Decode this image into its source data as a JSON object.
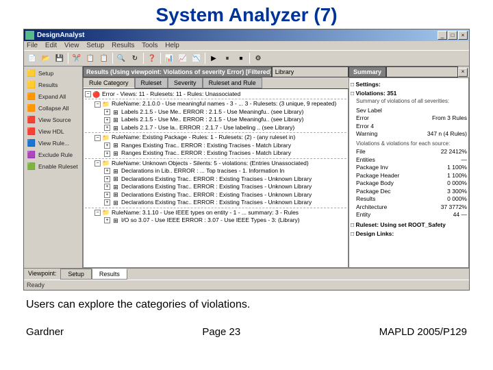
{
  "title": "System Analyzer (7)",
  "app": {
    "title": "DesignAnalyst",
    "menus": [
      "File",
      "Edit",
      "View",
      "Setup",
      "Results",
      "Tools",
      "Help"
    ],
    "toolbar_icons": [
      "📄",
      "📂",
      "💾",
      "|",
      "✂️",
      "📋",
      "📋",
      "|",
      "🔍",
      "↻",
      "|",
      "❓",
      "|",
      "📊",
      "📈",
      "📉",
      "|",
      "▶",
      "⏸",
      "⏹",
      "|",
      "⚙"
    ]
  },
  "sidebar": {
    "items": [
      {
        "icon": "🟨",
        "label": "Setup"
      },
      {
        "icon": "🟨",
        "label": "Results"
      },
      {
        "icon": "🟧",
        "label": "Expand All"
      },
      {
        "icon": "🟧",
        "label": "Collapse All"
      },
      {
        "icon": "🟥",
        "label": "View Source"
      },
      {
        "icon": "🟥",
        "label": "View HDL"
      },
      {
        "icon": "🟦",
        "label": "View Rule..."
      },
      {
        "icon": "🟪",
        "label": "Exclude Rule"
      },
      {
        "icon": "🟩",
        "label": "Enable Ruleset"
      }
    ]
  },
  "center": {
    "tab_main": "Results (Using viewpoint: Violations of severity Error) [Filtered]",
    "tab_lib": "Library",
    "sub_tabs": [
      "Rule Category",
      "Ruleset",
      "Severity",
      "Ruleset and Rule"
    ],
    "tree": [
      {
        "ind": 0,
        "box": "−",
        "icon": "🔴",
        "text": "Error - Views: 11 - Rulesets: 11 - Rules: Unassociated"
      },
      {
        "hr": true
      },
      {
        "ind": 1,
        "box": "−",
        "icon": "📁",
        "text": "RuleName: 2.1.0.0 - Use meaningful names - 3 - ... 3 - Rulesets: (3 unique, 9 repeated)"
      },
      {
        "ind": 2,
        "box": "",
        "icon": "⊞",
        "text": "Labels     2.1.5 - Use Me.. ERROR : 2.1.5 - Use Meaningfu.. (see Library)"
      },
      {
        "ind": 2,
        "box": "",
        "icon": "⊞",
        "text": "Labels     2.1.5 - Use Me.. ERROR : 2.1.5 - Use Meaningfu.. (see Library)"
      },
      {
        "ind": 2,
        "box": "",
        "icon": "⊞",
        "text": "Labels     2.1.7 - Use la.. ERROR : 2.1.7 - Use labeling .. (see Library)"
      },
      {
        "hr": true
      },
      {
        "ind": 1,
        "box": "−",
        "icon": "📁",
        "text": "RuleName: Existing Package - Rules: 1 - Rulesets: (2) - (any ruleset in)"
      },
      {
        "ind": 2,
        "box": "",
        "icon": "⊞",
        "text": "Ranges     Existing Trac.. ERROR : Existing Tracises - Match Library"
      },
      {
        "ind": 2,
        "box": "",
        "icon": "⊞",
        "text": "Ranges     Existing Trac.. ERROR : Existing Tracises - Match Library"
      },
      {
        "hr": true
      },
      {
        "ind": 1,
        "box": "−",
        "icon": "📁",
        "text": "RuleName: Unknown Objects - Silents: 5 - violations: (Entries Unassociated)"
      },
      {
        "ind": 2,
        "box": "",
        "icon": "⊞",
        "text": "Declarations  in Lib.. ERROR : ... Top tracises - 1. Information In"
      },
      {
        "ind": 2,
        "box": "",
        "icon": "⊞",
        "text": "Declarations  Existing Trac.. ERROR : Existing Tracises - Unknown Library"
      },
      {
        "ind": 2,
        "box": "",
        "icon": "⊞",
        "text": "Declarations  Existing Trac.. ERROR : Existing Tracises - Unknown Library"
      },
      {
        "ind": 2,
        "box": "",
        "icon": "⊞",
        "text": "Declarations  Existing Trac.. ERROR : Existing Tracises - Unknown Library"
      },
      {
        "ind": 2,
        "box": "",
        "icon": "⊞",
        "text": "Declarations  Existing Trac.. ERROR : Existing Tracises - Unknown Library"
      },
      {
        "hr": true
      },
      {
        "ind": 1,
        "box": "−",
        "icon": "📁",
        "text": "RuleName: 3.1.10 - Use IEEE types on entity - 1 - ... summary: 3 - Rules"
      },
      {
        "ind": 2,
        "box": "",
        "icon": "⊞",
        "text": "I/O so     3.07 - Use IEEE ERROR : 3.07 - Use IEEE Types - 3: (Library)"
      }
    ]
  },
  "right": {
    "tab": "Summary",
    "sections": {
      "settings": {
        "label": "Settings:"
      },
      "violations": {
        "label": "Violations: 351",
        "sub": "Summary of violations of all severities:"
      },
      "sev_table": [
        {
          "lab": "Sev Label",
          "val": ""
        },
        {
          "lab": "Error",
          "val": "From 3 Rules"
        },
        {
          "lab": "Error 4",
          "val": ""
        },
        {
          "lab": "Warning",
          "val": "347 n (4 Rules)"
        }
      ],
      "violations_hdr": "Violations & violations for each source:",
      "src_table": [
        {
          "lab": "File",
          "val": "22    2412%"
        },
        {
          "lab": "Entities",
          "val": "—"
        },
        {
          "lab": "Package Inv",
          "val": "1    100%"
        },
        {
          "lab": "Package Header",
          "val": "1    100%"
        },
        {
          "lab": "Package Body",
          "val": "0    000%"
        },
        {
          "lab": "Package Dec",
          "val": "3    300%"
        },
        {
          "lab": "Results",
          "val": "0    000%"
        },
        {
          "lab": "Architecture",
          "val": "37   3772%"
        },
        {
          "lab": "Entity",
          "val": "44    —"
        }
      ],
      "ruleset": "Ruleset: Using set ROOT_Safety",
      "links": "Design Links:"
    }
  },
  "bottom": {
    "label": "Viewpoint:",
    "tabs": [
      "Setup",
      "Results"
    ]
  },
  "status": "Ready",
  "caption": "Users can explore the categories of violations.",
  "footer": {
    "left": "Gardner",
    "center": "Page 23",
    "right": "MAPLD 2005/P129"
  }
}
